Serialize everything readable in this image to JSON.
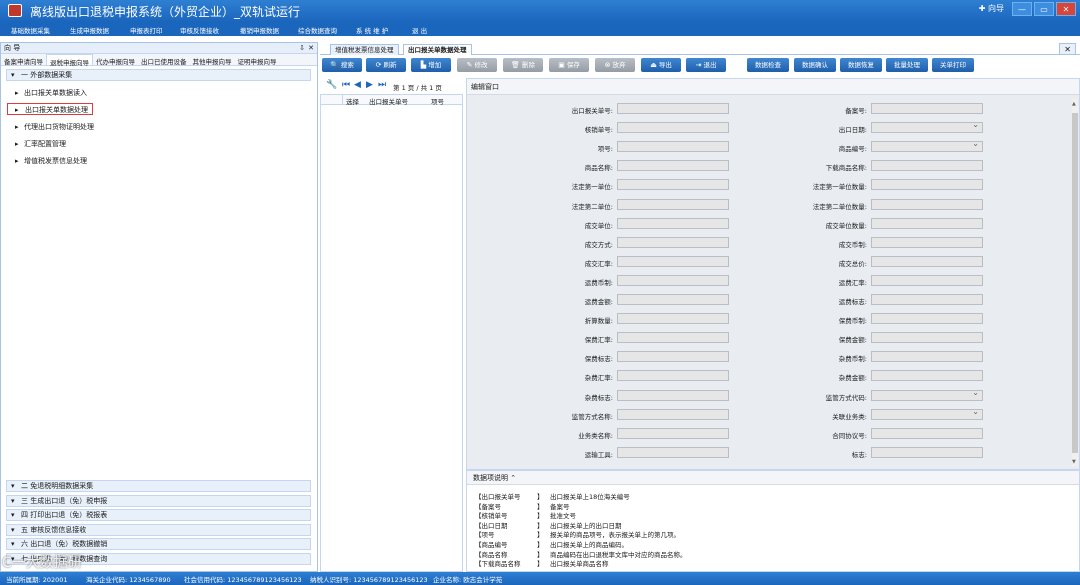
{
  "window": {
    "title": "离线版出口退税申报系统（外贸企业）_双轨试运行",
    "guide_label": "向导",
    "btn_min": "—",
    "btn_restore": "▭",
    "btn_close": "✕"
  },
  "menu": [
    "基础数据采集",
    "生成申报数据",
    "申报表打印",
    "审核反馈接收",
    "撤销申报数据",
    "综合数据查询",
    "系 统 维 护",
    "退  出"
  ],
  "left_panel": {
    "title": "向 导",
    "pin": "⇩",
    "close": "✕",
    "tabs": [
      "备案申请向导",
      "退税申报向导",
      "代办申报向导",
      "出口已使用设备",
      "其他申报向导",
      "证明申报向导"
    ],
    "section1": "一 外部数据采集",
    "items": [
      "出口报关单数据读入",
      "出口报关单数据处理",
      "代理出口货物证明处理",
      "汇率配置管理",
      "增值税发票信息处理"
    ],
    "sections_bottom": [
      "二 免退税明细数据采集",
      "三 生成出口退（免）税申报",
      "四 打印出口退（免）税报表",
      "五 审核反馈信息接收",
      "六 出口退（免）税数据撤销",
      "七 出口退（免）税数据查询"
    ]
  },
  "doc_tabs": [
    "增值税发票信息处理",
    "出口报关单数据处理"
  ],
  "toolbar": {
    "blue": [
      "搜索",
      "刷新",
      "增加"
    ],
    "gray": [
      "修改",
      "删除",
      "保存",
      "放弃"
    ],
    "blue2": [
      "导出",
      "退出"
    ],
    "right": [
      "数据检查",
      "数据确认",
      "数据恢复",
      "批量处理",
      "关单打印"
    ]
  },
  "pager": {
    "text": "第 1 页 / 共 1 页"
  },
  "list_headers": [
    "选择",
    "出口报关单号",
    "项号"
  ],
  "edit": {
    "title": "编辑窗口",
    "left_fields": [
      "出口报关单号:",
      "核销单号:",
      "项号:",
      "商品名称:",
      "法定第一单位:",
      "法定第二单位:",
      "成交单位:",
      "成交方式:",
      "成交汇率:",
      "运费币制:",
      "运费金额:",
      "折算数量:",
      "保费汇率:",
      "保费标志:",
      "杂费汇率:",
      "杂费标志:",
      "监管方式名称:",
      "业务类名称:",
      "运输工具:"
    ],
    "right_fields": [
      "备案号:",
      "出口日期:",
      "商品编号:",
      "下载商品名称:",
      "法定第一单位数量:",
      "法定第二单位数量:",
      "成交单位数量:",
      "成交币制:",
      "成交总价:",
      "运费汇率:",
      "运费标志:",
      "保费币制:",
      "保费金额:",
      "杂费币制:",
      "杂费金额:",
      "监管方式代码:",
      "关联业务类:",
      "合同协议号:",
      "标志:"
    ]
  },
  "desc": {
    "title": "数据项说明",
    "rows": [
      {
        "k": "【出口报关单号",
        "v": "出口报关单上18位海关编号"
      },
      {
        "k": "【备案号",
        "v": "备案号"
      },
      {
        "k": "【核销单号",
        "v": "批准文号"
      },
      {
        "k": "【出口日期",
        "v": "出口报关单上的出口日期"
      },
      {
        "k": "【项号",
        "v": "报关单的商品项号，表示报关单上的第几项。"
      },
      {
        "k": "【商品编号",
        "v": "出口报关单上的商品编码。"
      },
      {
        "k": "【商品名称",
        "v": "商品编码在出口退税率文库中对应的商品名称。"
      },
      {
        "k": "【下载商品名称",
        "v": "出口报关单商品名称"
      }
    ]
  },
  "status": {
    "a": "当前所属期: 202001",
    "b": "海关企业代码: 1234567890",
    "c": "社会信用代码: 123456789123456123",
    "d": "纳税人识别号: 123456789123456123",
    "e": "企业名称: 欧志会计学苑"
  },
  "watermark": "C一大数据研"
}
